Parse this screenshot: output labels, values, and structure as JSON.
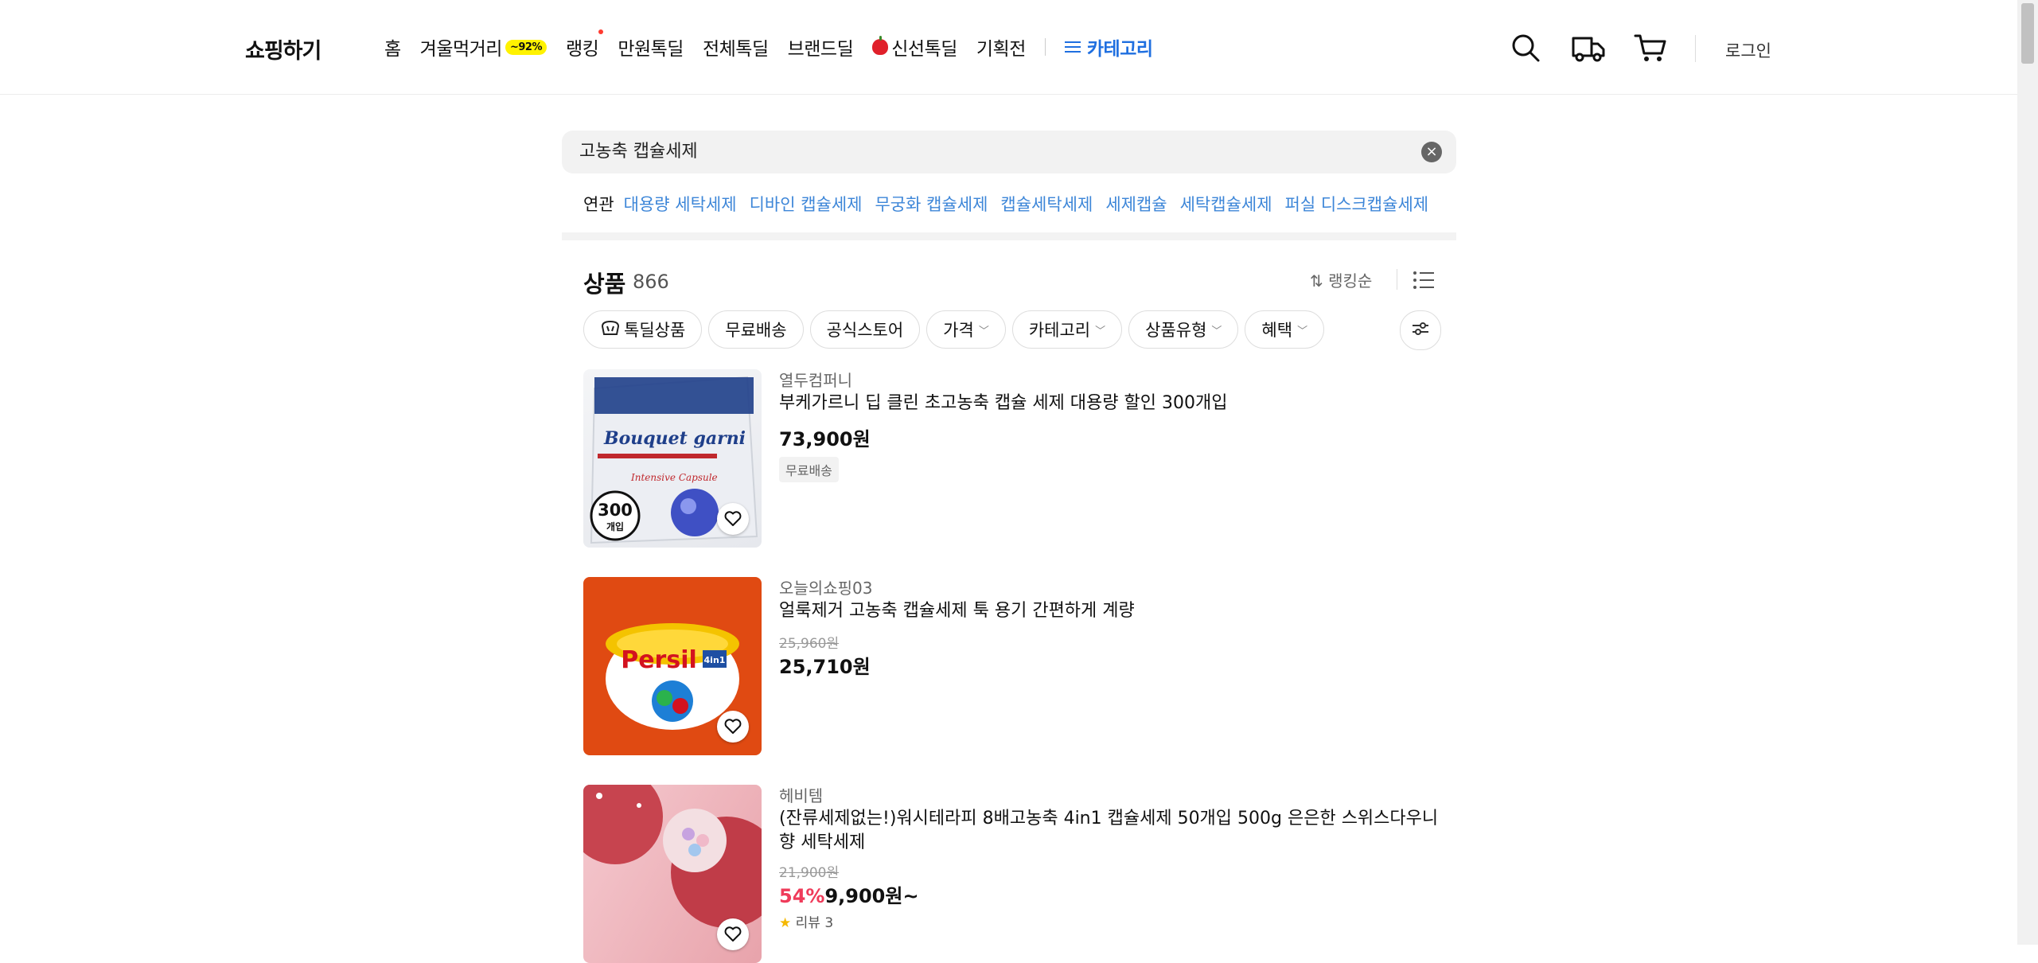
{
  "header": {
    "logo": "쇼핑하기",
    "nav": [
      {
        "label": "홈"
      },
      {
        "label": "겨울먹거리",
        "badge": "~92%"
      },
      {
        "label": "랭킹",
        "dot": true
      },
      {
        "label": "만원톡딜"
      },
      {
        "label": "전체톡딜"
      },
      {
        "label": "브랜드딜"
      },
      {
        "label": "신선톡딜",
        "icon": "apple-icon"
      },
      {
        "label": "기획전"
      }
    ],
    "category_label": "카테고리",
    "icons": [
      "search-icon",
      "delivery-truck-icon",
      "cart-icon"
    ],
    "login_label": "로그인",
    "accent_color": "#1f6fe0"
  },
  "search": {
    "query": "고농축 캡슐세제",
    "clear_icon": "close-icon"
  },
  "related": {
    "label": "연관",
    "links": [
      "대용량 세탁세제",
      "디바인 캡슐세제",
      "무궁화 캡슐세제",
      "캡슐세탁세제",
      "세제캡슐",
      "세탁캡슐세제",
      "퍼실 디스크캡슐세제"
    ]
  },
  "products_header": {
    "title": "상품",
    "count": "866",
    "sort_label": "랭킹순"
  },
  "filters": [
    {
      "label": "톡딜상품",
      "icon": "talkdeal-icon"
    },
    {
      "label": "무료배송"
    },
    {
      "label": "공식스토어"
    },
    {
      "label": "가격",
      "dropdown": true
    },
    {
      "label": "카테고리",
      "dropdown": true
    },
    {
      "label": "상품유형",
      "dropdown": true
    },
    {
      "label": "혜택",
      "dropdown": true
    }
  ],
  "products": [
    {
      "store": "열두컴퍼니",
      "name": "부케가르니 딥 클린 초고농축 캡슐 세제 대용량 할인 300개입",
      "price": "73,900원",
      "tag": "무료배송",
      "image_text": {
        "brand": "Bouquet garni",
        "count_num": "300",
        "count_unit": "개입"
      }
    },
    {
      "store": "오늘의쇼핑03",
      "name": "얼룩제거 고농축 캡슐세제 툭 용기 간편하게 계량",
      "original_price": "25,960원",
      "price": "25,710원",
      "image_text": {
        "brand": "Persil",
        "badge": "4in1"
      }
    },
    {
      "store": "헤비템",
      "name": "(잔류세제없는!)워시테라피 8배고농축 4in1 캡슐세제 50개입 500g 은은한 스위스다우니향 세탁세제",
      "original_price": "21,900원",
      "discount": "54%",
      "price": "9,900원~",
      "review_label": "리뷰 3"
    }
  ],
  "colors": {
    "discount": "#ef3b5a",
    "related_link": "#3d86d8",
    "persil_bg": "#e04a12"
  }
}
